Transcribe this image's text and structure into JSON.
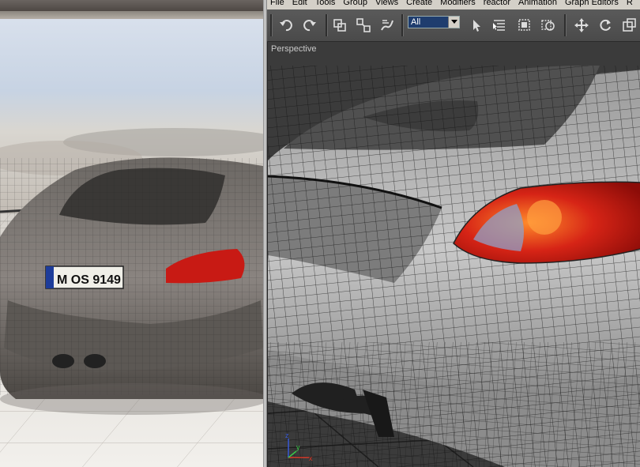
{
  "menu": {
    "items": [
      "File",
      "Edit",
      "Tools",
      "Group",
      "Views",
      "Create",
      "Modifiers",
      "reactor",
      "Animation",
      "Graph Editors",
      "R"
    ]
  },
  "toolbar": {
    "selection_filter": "All",
    "icons": [
      "undo-icon",
      "redo-icon",
      "select-and-link-icon",
      "unlink-selection-icon",
      "bind-to-space-warp-icon",
      "select-object-icon",
      "select-by-name-icon",
      "rectangular-selection-region-icon",
      "window-crossing-icon",
      "select-and-move-icon",
      "select-and-rotate-icon",
      "select-and-scale-icon"
    ]
  },
  "viewport": {
    "label": "Perspective",
    "axes": {
      "x": "x",
      "y": "y",
      "z": "z"
    }
  },
  "render": {
    "license_plate": "M OS 9149"
  },
  "colors": {
    "menu_bg": "#d4d0c8",
    "toolbar_bg": "#4e4e4e",
    "viewport_bg": "#3b3b3b",
    "filter_bg": "#1f3d6e",
    "taillight": "#c81a14"
  }
}
